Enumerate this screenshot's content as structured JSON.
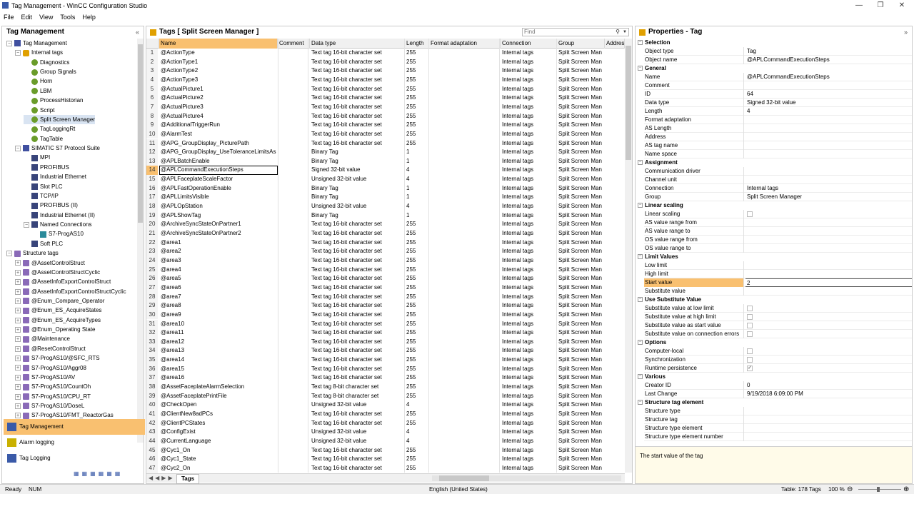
{
  "window": {
    "title": "Tag Management - WinCC Configuration Studio"
  },
  "menu": [
    "File",
    "Edit",
    "View",
    "Tools",
    "Help"
  ],
  "nav": {
    "header": "Tag Management",
    "tree": [
      {
        "label": "Tag Management",
        "depth": 0,
        "toggle": "−",
        "icon": "plc"
      },
      {
        "label": "Internal tags",
        "depth": 1,
        "toggle": "−",
        "icon": "tags"
      },
      {
        "label": "Diagnostics",
        "depth": 2,
        "toggle": "",
        "icon": "gear"
      },
      {
        "label": "Group Signals",
        "depth": 2,
        "toggle": "",
        "icon": "gear"
      },
      {
        "label": "Horn",
        "depth": 2,
        "toggle": "",
        "icon": "gear"
      },
      {
        "label": "LBM",
        "depth": 2,
        "toggle": "",
        "icon": "gear"
      },
      {
        "label": "ProcessHistorian",
        "depth": 2,
        "toggle": "",
        "icon": "gear"
      },
      {
        "label": "Script",
        "depth": 2,
        "toggle": "",
        "icon": "gear"
      },
      {
        "label": "Split Screen Manager",
        "depth": 2,
        "toggle": "",
        "icon": "gear",
        "selected": true
      },
      {
        "label": "TagLoggingRt",
        "depth": 2,
        "toggle": "",
        "icon": "gear"
      },
      {
        "label": "TagTable",
        "depth": 2,
        "toggle": "",
        "icon": "gear"
      },
      {
        "label": "SIMATIC S7 Protocol Suite",
        "depth": 1,
        "toggle": "−",
        "icon": "plc"
      },
      {
        "label": "MPI",
        "depth": 2,
        "toggle": "",
        "icon": "net"
      },
      {
        "label": "PROFIBUS",
        "depth": 2,
        "toggle": "",
        "icon": "net"
      },
      {
        "label": "Industrial Ethernet",
        "depth": 2,
        "toggle": "",
        "icon": "net"
      },
      {
        "label": "Slot PLC",
        "depth": 2,
        "toggle": "",
        "icon": "net"
      },
      {
        "label": "TCP/IP",
        "depth": 2,
        "toggle": "",
        "icon": "net"
      },
      {
        "label": "PROFIBUS (II)",
        "depth": 2,
        "toggle": "",
        "icon": "net"
      },
      {
        "label": "Industrial Ethernet (II)",
        "depth": 2,
        "toggle": "",
        "icon": "net"
      },
      {
        "label": "Named Connections",
        "depth": 2,
        "toggle": "−",
        "icon": "net"
      },
      {
        "label": "S7-ProgAS10",
        "depth": 3,
        "toggle": "",
        "icon": "prog"
      },
      {
        "label": "Soft PLC",
        "depth": 2,
        "toggle": "",
        "icon": "net"
      },
      {
        "label": "Structure tags",
        "depth": 0,
        "toggle": "−",
        "icon": "struct"
      },
      {
        "label": "@AssetControlStruct",
        "depth": 1,
        "toggle": "+",
        "icon": "struct"
      },
      {
        "label": "@AssetControlStructCyclic",
        "depth": 1,
        "toggle": "+",
        "icon": "struct"
      },
      {
        "label": "@AssetInfoExportControlStruct",
        "depth": 1,
        "toggle": "+",
        "icon": "struct"
      },
      {
        "label": "@AssetInfoExportControlStructCyclic",
        "depth": 1,
        "toggle": "+",
        "icon": "struct"
      },
      {
        "label": "@Enum_Compare_Operator",
        "depth": 1,
        "toggle": "+",
        "icon": "struct"
      },
      {
        "label": "@Enum_ES_AcquireStates",
        "depth": 1,
        "toggle": "+",
        "icon": "struct"
      },
      {
        "label": "@Enum_ES_AcquireTypes",
        "depth": 1,
        "toggle": "+",
        "icon": "struct"
      },
      {
        "label": "@Enum_Operating State",
        "depth": 1,
        "toggle": "+",
        "icon": "struct"
      },
      {
        "label": "@Maintenance",
        "depth": 1,
        "toggle": "+",
        "icon": "struct"
      },
      {
        "label": "@ResetControlStruct",
        "depth": 1,
        "toggle": "+",
        "icon": "struct"
      },
      {
        "label": "S7-ProgAS10/@SFC_RTS",
        "depth": 1,
        "toggle": "+",
        "icon": "struct"
      },
      {
        "label": "S7-ProgAS10/Aggr08",
        "depth": 1,
        "toggle": "+",
        "icon": "struct"
      },
      {
        "label": "S7-ProgAS10/AV",
        "depth": 1,
        "toggle": "+",
        "icon": "struct"
      },
      {
        "label": "S7-ProgAS10/CountOh",
        "depth": 1,
        "toggle": "+",
        "icon": "struct"
      },
      {
        "label": "S7-ProgAS10/CPU_RT",
        "depth": 1,
        "toggle": "+",
        "icon": "struct"
      },
      {
        "label": "S7-ProgAS10/DoseL",
        "depth": 1,
        "toggle": "+",
        "icon": "struct"
      },
      {
        "label": "S7-ProgAS10/FMT_ReactorGas",
        "depth": 1,
        "toggle": "+",
        "icon": "struct"
      }
    ],
    "bottom": [
      {
        "label": "Tag Management",
        "active": true
      },
      {
        "label": "Alarm logging",
        "active": false
      },
      {
        "label": "Tag Logging",
        "active": false
      }
    ]
  },
  "grid": {
    "title": "Tags [ Split Screen Manager ]",
    "find_placeholder": "Find",
    "columns": [
      "Name",
      "Comment",
      "Data type",
      "Length",
      "Format adaptation",
      "Connection",
      "Group",
      "Addres"
    ],
    "sheet_tab": "Tags",
    "rows": [
      [
        "1",
        "@ActionType",
        "",
        "Text tag 16-bit character set",
        "255",
        "",
        "Internal tags",
        "Split Screen Man"
      ],
      [
        "2",
        "@ActionType1",
        "",
        "Text tag 16-bit character set",
        "255",
        "",
        "Internal tags",
        "Split Screen Man"
      ],
      [
        "3",
        "@ActionType2",
        "",
        "Text tag 16-bit character set",
        "255",
        "",
        "Internal tags",
        "Split Screen Man"
      ],
      [
        "4",
        "@ActionType3",
        "",
        "Text tag 16-bit character set",
        "255",
        "",
        "Internal tags",
        "Split Screen Man"
      ],
      [
        "5",
        "@ActualPicture1",
        "",
        "Text tag 16-bit character set",
        "255",
        "",
        "Internal tags",
        "Split Screen Man"
      ],
      [
        "6",
        "@ActualPicture2",
        "",
        "Text tag 16-bit character set",
        "255",
        "",
        "Internal tags",
        "Split Screen Man"
      ],
      [
        "7",
        "@ActualPicture3",
        "",
        "Text tag 16-bit character set",
        "255",
        "",
        "Internal tags",
        "Split Screen Man"
      ],
      [
        "8",
        "@ActualPicture4",
        "",
        "Text tag 16-bit character set",
        "255",
        "",
        "Internal tags",
        "Split Screen Man"
      ],
      [
        "9",
        "@AdditionalTriggerRun",
        "",
        "Text tag 16-bit character set",
        "255",
        "",
        "Internal tags",
        "Split Screen Man"
      ],
      [
        "10",
        "@AlarmTest",
        "",
        "Text tag 16-bit character set",
        "255",
        "",
        "Internal tags",
        "Split Screen Man"
      ],
      [
        "11",
        "@APG_GroupDisplay_PicturePath",
        "",
        "Text tag 16-bit character set",
        "255",
        "",
        "Internal tags",
        "Split Screen Man"
      ],
      [
        "12",
        "@APG_GroupDisplay_UseToleranceLimitsAs",
        "",
        "Binary Tag",
        "1",
        "",
        "Internal tags",
        "Split Screen Man"
      ],
      [
        "13",
        "@APLBatchEnable",
        "",
        "Binary Tag",
        "1",
        "",
        "Internal tags",
        "Split Screen Man"
      ],
      [
        "14",
        "@APLCommandExecutionSteps",
        "",
        "Signed 32-bit value",
        "4",
        "",
        "Internal tags",
        "Split Screen Man"
      ],
      [
        "15",
        "@APLFaceplateScaleFactor",
        "",
        "Unsigned 32-bit value",
        "4",
        "",
        "Internal tags",
        "Split Screen Man"
      ],
      [
        "16",
        "@APLFastOperationEnable",
        "",
        "Binary Tag",
        "1",
        "",
        "Internal tags",
        "Split Screen Man"
      ],
      [
        "17",
        "@APLLimitsVisible",
        "",
        "Binary Tag",
        "1",
        "",
        "Internal tags",
        "Split Screen Man"
      ],
      [
        "18",
        "@APLOpStation",
        "",
        "Unsigned 32-bit value",
        "4",
        "",
        "Internal tags",
        "Split Screen Man"
      ],
      [
        "19",
        "@APLShowTag",
        "",
        "Binary Tag",
        "1",
        "",
        "Internal tags",
        "Split Screen Man"
      ],
      [
        "20",
        "@ArchiveSyncStateOnPartner1",
        "",
        "Text tag 16-bit character set",
        "255",
        "",
        "Internal tags",
        "Split Screen Man"
      ],
      [
        "21",
        "@ArchiveSyncStateOnPartner2",
        "",
        "Text tag 16-bit character set",
        "255",
        "",
        "Internal tags",
        "Split Screen Man"
      ],
      [
        "22",
        "@area1",
        "",
        "Text tag 16-bit character set",
        "255",
        "",
        "Internal tags",
        "Split Screen Man"
      ],
      [
        "23",
        "@area2",
        "",
        "Text tag 16-bit character set",
        "255",
        "",
        "Internal tags",
        "Split Screen Man"
      ],
      [
        "24",
        "@area3",
        "",
        "Text tag 16-bit character set",
        "255",
        "",
        "Internal tags",
        "Split Screen Man"
      ],
      [
        "25",
        "@area4",
        "",
        "Text tag 16-bit character set",
        "255",
        "",
        "Internal tags",
        "Split Screen Man"
      ],
      [
        "26",
        "@area5",
        "",
        "Text tag 16-bit character set",
        "255",
        "",
        "Internal tags",
        "Split Screen Man"
      ],
      [
        "27",
        "@area6",
        "",
        "Text tag 16-bit character set",
        "255",
        "",
        "Internal tags",
        "Split Screen Man"
      ],
      [
        "28",
        "@area7",
        "",
        "Text tag 16-bit character set",
        "255",
        "",
        "Internal tags",
        "Split Screen Man"
      ],
      [
        "29",
        "@area8",
        "",
        "Text tag 16-bit character set",
        "255",
        "",
        "Internal tags",
        "Split Screen Man"
      ],
      [
        "30",
        "@area9",
        "",
        "Text tag 16-bit character set",
        "255",
        "",
        "Internal tags",
        "Split Screen Man"
      ],
      [
        "31",
        "@area10",
        "",
        "Text tag 16-bit character set",
        "255",
        "",
        "Internal tags",
        "Split Screen Man"
      ],
      [
        "32",
        "@area11",
        "",
        "Text tag 16-bit character set",
        "255",
        "",
        "Internal tags",
        "Split Screen Man"
      ],
      [
        "33",
        "@area12",
        "",
        "Text tag 16-bit character set",
        "255",
        "",
        "Internal tags",
        "Split Screen Man"
      ],
      [
        "34",
        "@area13",
        "",
        "Text tag 16-bit character set",
        "255",
        "",
        "Internal tags",
        "Split Screen Man"
      ],
      [
        "35",
        "@area14",
        "",
        "Text tag 16-bit character set",
        "255",
        "",
        "Internal tags",
        "Split Screen Man"
      ],
      [
        "36",
        "@area15",
        "",
        "Text tag 16-bit character set",
        "255",
        "",
        "Internal tags",
        "Split Screen Man"
      ],
      [
        "37",
        "@area16",
        "",
        "Text tag 16-bit character set",
        "255",
        "",
        "Internal tags",
        "Split Screen Man"
      ],
      [
        "38",
        "@AssetFaceplateAlarmSelection",
        "",
        "Text tag 8-bit character set",
        "255",
        "",
        "Internal tags",
        "Split Screen Man"
      ],
      [
        "39",
        "@AssetFaceplatePrintFile",
        "",
        "Text tag 8-bit character set",
        "255",
        "",
        "Internal tags",
        "Split Screen Man"
      ],
      [
        "40",
        "@CheckOpen",
        "",
        "Unsigned 32-bit value",
        "4",
        "",
        "Internal tags",
        "Split Screen Man"
      ],
      [
        "41",
        "@ClientNew8adPCs",
        "",
        "Text tag 16-bit character set",
        "255",
        "",
        "Internal tags",
        "Split Screen Man"
      ],
      [
        "42",
        "@ClientPCStates",
        "",
        "Text tag 16-bit character set",
        "255",
        "",
        "Internal tags",
        "Split Screen Man"
      ],
      [
        "43",
        "@ConfigExist",
        "",
        "Unsigned 32-bit value",
        "4",
        "",
        "Internal tags",
        "Split Screen Man"
      ],
      [
        "44",
        "@CurrentLanguage",
        "",
        "Unsigned 32-bit value",
        "4",
        "",
        "Internal tags",
        "Split Screen Man"
      ],
      [
        "45",
        "@Cyc1_On",
        "",
        "Text tag 16-bit character set",
        "255",
        "",
        "Internal tags",
        "Split Screen Man"
      ],
      [
        "46",
        "@Cyc1_State",
        "",
        "Text tag 16-bit character set",
        "255",
        "",
        "Internal tags",
        "Split Screen Man"
      ],
      [
        "47",
        "@Cyc2_On",
        "",
        "Text tag 16-bit character set",
        "255",
        "",
        "Internal tags",
        "Split Screen Man"
      ]
    ],
    "selected_row": 14
  },
  "props": {
    "title": "Properties - Tag",
    "sections": [
      {
        "cat": "Selection",
        "rows": [
          [
            "Object type",
            "Tag"
          ],
          [
            "Object name",
            "@APLCommandExecutionSteps"
          ]
        ]
      },
      {
        "cat": "General",
        "rows": [
          [
            "Name",
            "@APLCommandExecutionSteps"
          ],
          [
            "Comment",
            ""
          ],
          [
            "ID",
            "64"
          ],
          [
            "Data type",
            "Signed 32-bit value"
          ],
          [
            "Length",
            "4"
          ],
          [
            "Format adaptation",
            ""
          ],
          [
            "AS Length",
            ""
          ],
          [
            "Address",
            ""
          ],
          [
            "AS tag name",
            ""
          ],
          [
            "Name space",
            ""
          ]
        ]
      },
      {
        "cat": "Assignment",
        "rows": [
          [
            "Communication driver",
            ""
          ],
          [
            "Channel unit",
            ""
          ],
          [
            "Connection",
            "Internal tags"
          ],
          [
            "Group",
            "Split Screen Manager"
          ]
        ]
      },
      {
        "cat": "Linear scaling",
        "rows": [
          [
            "Linear scaling",
            "chk:off"
          ],
          [
            "AS value range from",
            ""
          ],
          [
            "AS value range to",
            ""
          ],
          [
            "OS value range from",
            ""
          ],
          [
            "OS value range to",
            ""
          ]
        ]
      },
      {
        "cat": "Limit Values",
        "rows": [
          [
            "Low limit",
            ""
          ],
          [
            "High limit",
            ""
          ],
          [
            "Start value",
            "2"
          ],
          [
            "Substitute value",
            ""
          ]
        ]
      },
      {
        "cat": "Use Substitute Value",
        "rows": [
          [
            "Substitute value at low limit",
            "chk:off"
          ],
          [
            "Substitute value at high limit",
            "chk:off"
          ],
          [
            "Substitute value as start value",
            "chk:off"
          ],
          [
            "Substitute value on connection errors",
            "chk:off"
          ]
        ]
      },
      {
        "cat": "Options",
        "rows": [
          [
            "Computer-local",
            "chk:off"
          ],
          [
            "Synchronization",
            "chk:off"
          ],
          [
            "Runtime persistence",
            "chk:on"
          ]
        ]
      },
      {
        "cat": "Various",
        "rows": [
          [
            "Creator ID",
            "0"
          ],
          [
            "Last Change",
            "9/19/2018 6:09:00 PM"
          ]
        ]
      },
      {
        "cat": "Structure tag element",
        "rows": [
          [
            "Structure type",
            ""
          ],
          [
            "Structure tag",
            ""
          ],
          [
            "Structure type element",
            ""
          ],
          [
            "Structure type element number",
            ""
          ]
        ]
      }
    ],
    "highlight_row": "Start value",
    "description": "The start value of the tag"
  },
  "status": {
    "ready": "Ready",
    "num": "NUM",
    "language": "English (United States)",
    "table": "Table: 178 Tags",
    "zoom": "100 %"
  },
  "colors": {
    "accent": "#f9c070",
    "selection": "#d9e4f2"
  }
}
